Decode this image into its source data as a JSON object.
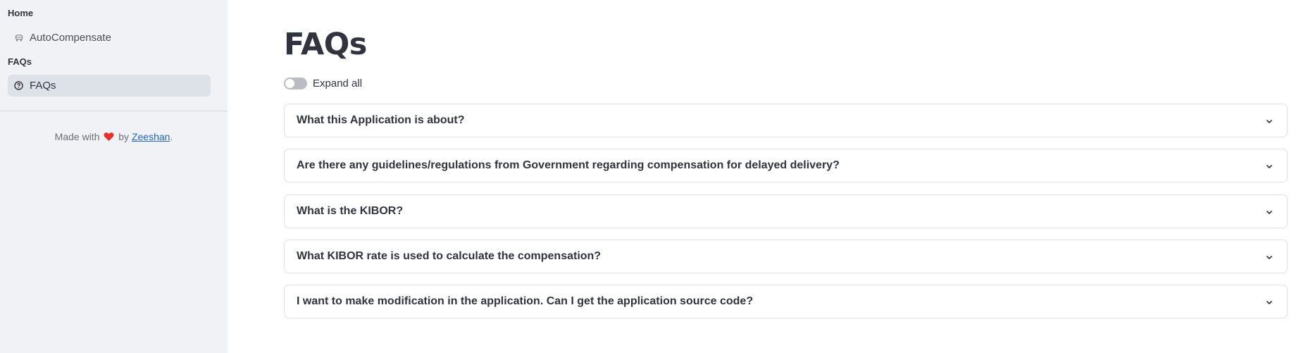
{
  "sidebar": {
    "sections": [
      {
        "label": "Home",
        "items": [
          {
            "label": "AutoCompensate",
            "icon": "car-icon",
            "active": false
          }
        ]
      },
      {
        "label": "FAQs",
        "items": [
          {
            "label": "FAQs",
            "icon": "help-circle-icon",
            "active": true
          }
        ]
      }
    ],
    "footer": {
      "prefix": "Made with",
      "by": "by",
      "author": "Zeeshan",
      "suffix": "."
    }
  },
  "main": {
    "title": "FAQs",
    "expand_all_label": "Expand all",
    "expand_all_on": false,
    "faqs": [
      "What this Application is about?",
      "Are there any guidelines/regulations from Government regarding compensation for delayed delivery?",
      "What is the KIBOR?",
      "What KIBOR rate is used to calculate the compensation?",
      "I want to make modification in the application. Can I get the application source code?"
    ]
  },
  "colors": {
    "sidebar_bg": "#f0f2f6",
    "active_item_bg": "#dde1e8",
    "text": "#31333f",
    "link": "#1f68b6",
    "heart": "#e8302c"
  }
}
